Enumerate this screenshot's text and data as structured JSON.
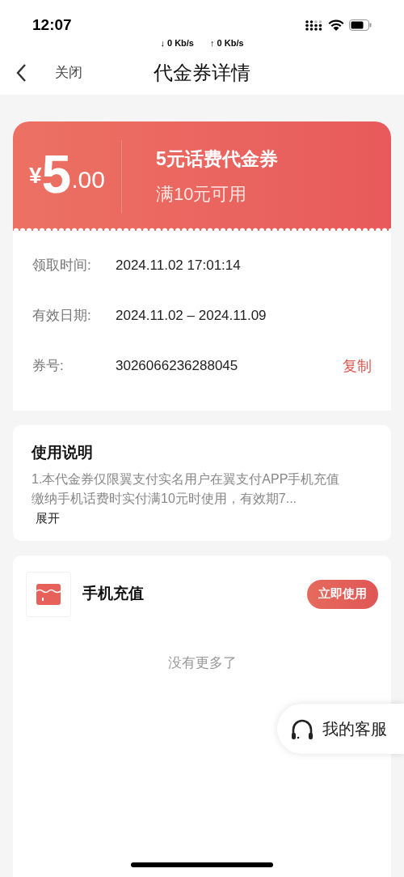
{
  "status_bar": {
    "time": "12:07",
    "net_down": "↓ 0 Kb/s",
    "net_up": "↑ 0 Kb/s"
  },
  "nav": {
    "close": "关闭",
    "title": "代金券详情"
  },
  "coupon": {
    "currency": "¥",
    "amount_int": "5",
    "amount_dec": ".00",
    "name": "5元话费代金券",
    "condition": "满10元可用",
    "details": [
      {
        "label": "领取时间:",
        "value": "2024.11.02 17:01:14"
      },
      {
        "label": "有效日期:",
        "value": "2024.11.02 – 2024.11.09"
      },
      {
        "label": "券号:",
        "value": "3026066236288045",
        "action": "复制"
      }
    ]
  },
  "instructions": {
    "title": "使用说明",
    "text": "1.本代金券仅限翼支付实名用户在翼支付APP手机充值缴纳手机话费时实付满10元时使用，有效期7...",
    "expand": "展开"
  },
  "merchant": {
    "name": "手机充值",
    "button": "立即使用",
    "footer": "没有更多了"
  },
  "service": {
    "label": "我的客服"
  }
}
